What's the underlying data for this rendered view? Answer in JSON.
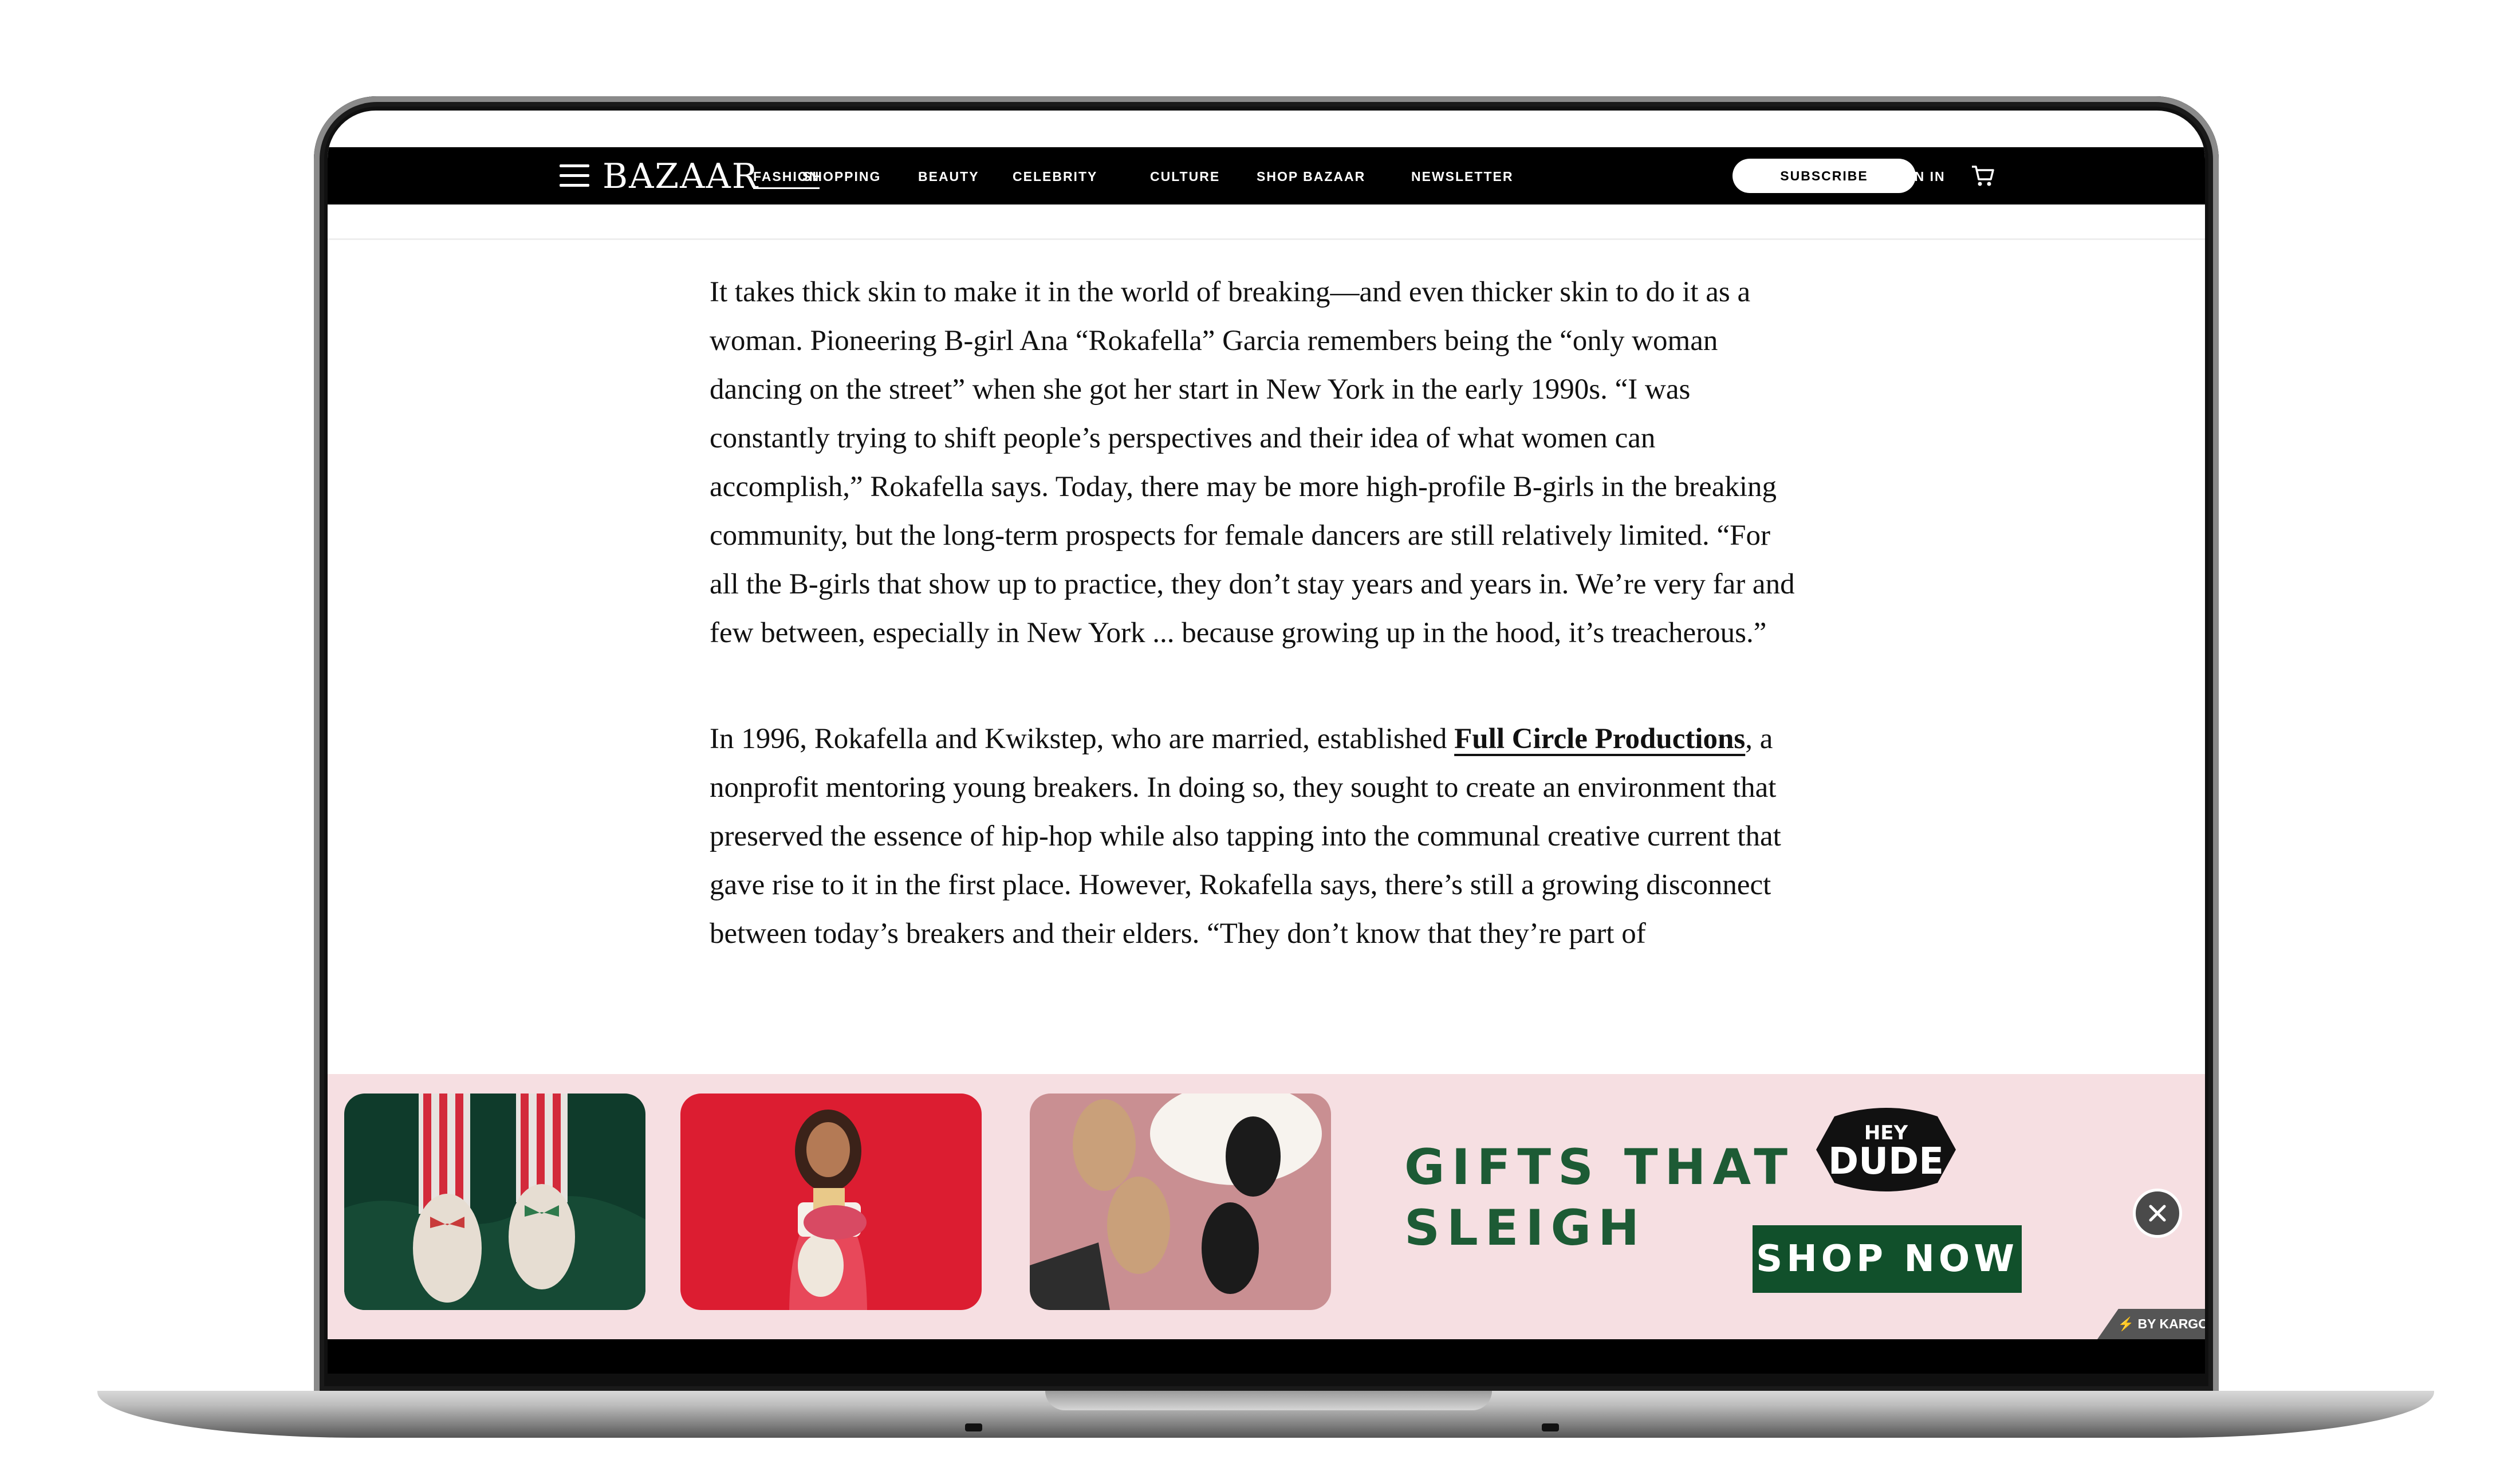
{
  "nav": {
    "logo": "BAZAAR",
    "links": [
      "FASHION",
      "SHOPPING",
      "BEAUTY",
      "CELEBRITY",
      "CULTURE",
      "SHOP BAZAAR",
      "NEWSLETTER"
    ],
    "subscribe": "SUBSCRIBE",
    "sign_in": "SIGN IN",
    "icons": [
      "menu-icon",
      "cart-icon"
    ]
  },
  "article": {
    "p1": "It takes thick skin to make it in the world of breaking—and even thicker skin to do it as a woman. Pioneering B-girl Ana “Rokafella” Garcia remembers being the “only woman dancing on the street” when she got her start in New York in the early 1990s. “I was constantly trying to shift people’s perspectives and their idea of what women can accomplish,” Rokafella says. Today, there may be more high-profile B-girls in the breaking community, but the long-term prospects for female dancers are still relatively limited. “For all the B-girls that show up to practice, they don’t stay years and years in. We’re very far and few between, especially in New York ... because growing up in the hood, it’s treacherous.”",
    "p2_before": "In 1996, Rokafella and Kwikstep, who are married, established ",
    "p2_link": "Full Circle Productions",
    "p2_after": ", a nonprofit mentoring young breakers. In doing so, they sought to create an environment that preserved the essence of hip-hop while also tapping into the communal creative current that gave rise to it in the first place. However, Rokafella says, there’s still a growing disconnect between today’s breakers and their elders. “They don’t know that they’re part of"
  },
  "ad": {
    "headline_line1": "GIFTS THAT",
    "headline_line2": "SLEIGH",
    "brand_top": "HEY",
    "brand_bottom": "DUDE",
    "cta": "SHOP NOW",
    "badge": "BY KARGO",
    "colors": {
      "background": "#f6dfe2",
      "green": "#11502b",
      "red": "#d9182c"
    }
  }
}
